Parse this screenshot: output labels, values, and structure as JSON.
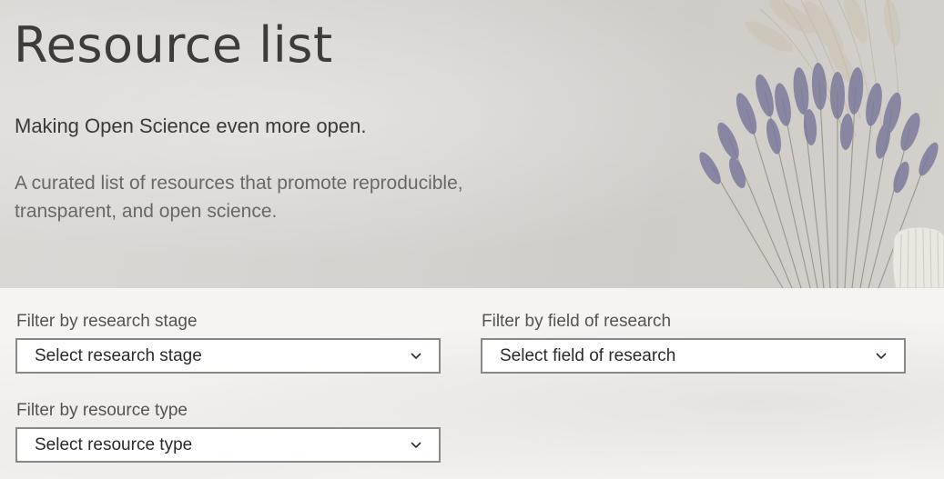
{
  "hero": {
    "title": "Resource list",
    "subtitle": "Making Open Science even more open.",
    "description": "A curated list of resources that promote reproducible, transparent, and open science."
  },
  "filters": {
    "stage": {
      "label": "Filter by research stage",
      "placeholder": "Select research stage",
      "icon": "chevron-down-icon"
    },
    "field": {
      "label": "Filter by field of research",
      "placeholder": "Select field of research",
      "icon": "chevron-down-icon"
    },
    "type": {
      "label": "Filter by resource type",
      "placeholder": "Select resource type",
      "icon": "chevron-down-icon"
    }
  },
  "colors": {
    "title_text": "#3d3c3a",
    "description_text": "#6a6865",
    "select_border": "#8a8885",
    "lavender": "#7c7a9b"
  }
}
